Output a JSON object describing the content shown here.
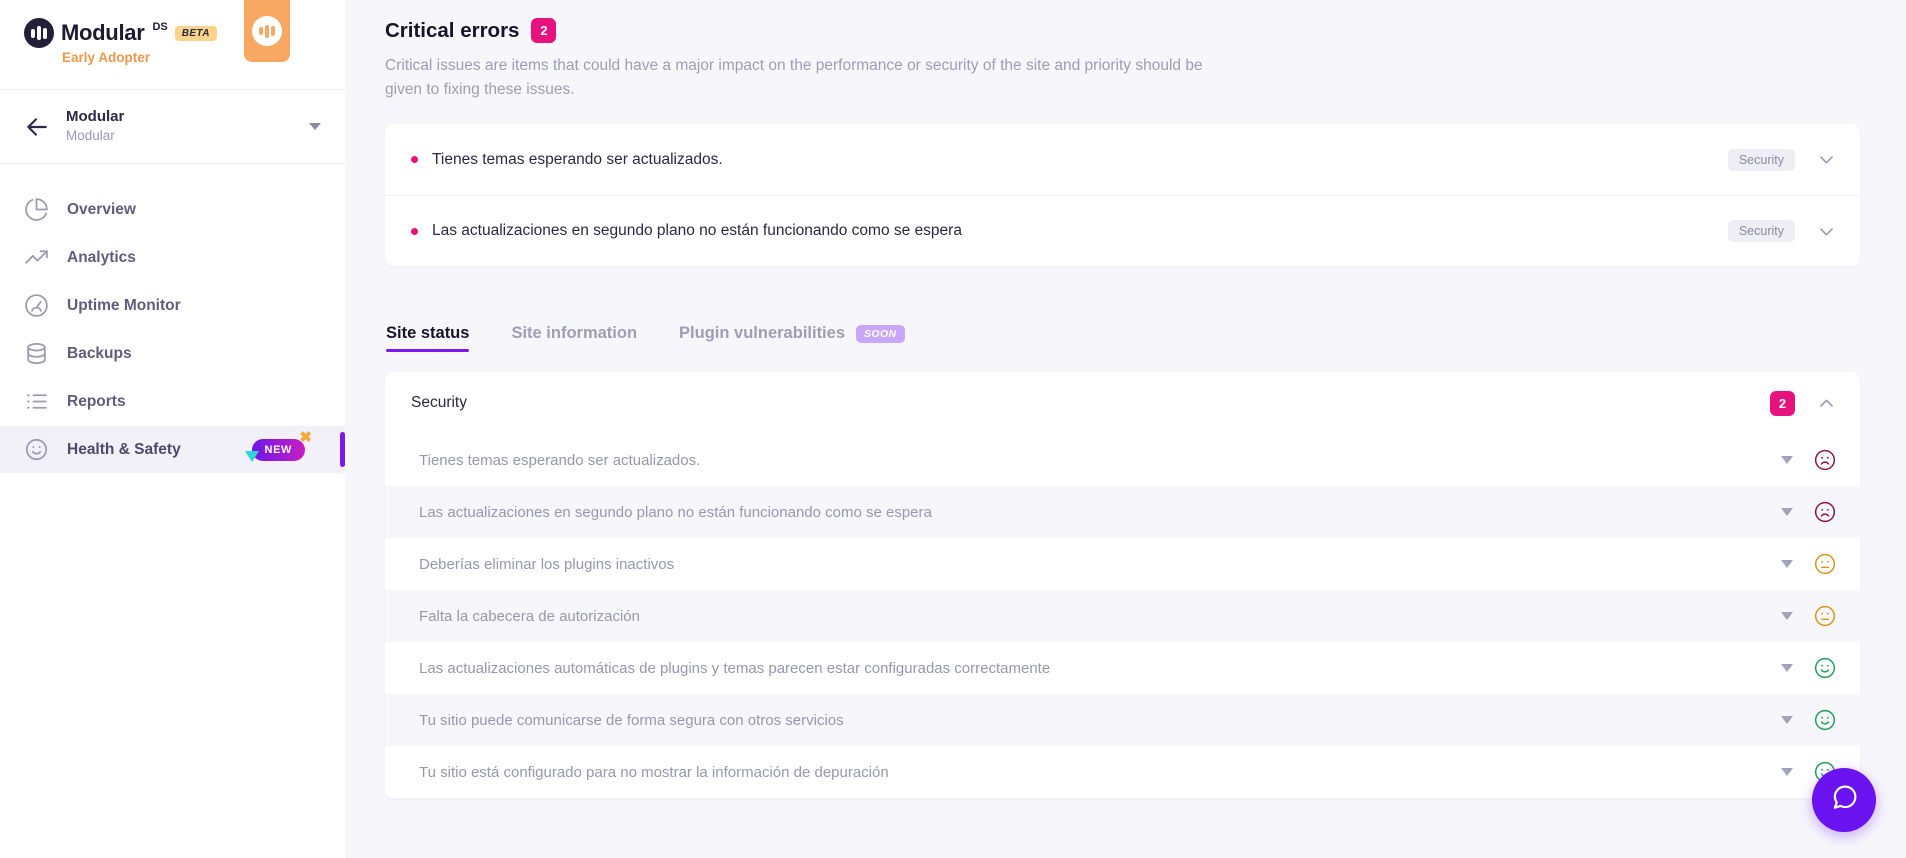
{
  "brand": {
    "name": "Modular",
    "superscript": "DS",
    "beta_label": "BETA",
    "subtitle": "Early Adopter"
  },
  "site_selector": {
    "name": "Modular",
    "host": "Modular"
  },
  "sidebar": {
    "items": [
      {
        "label": "Overview",
        "icon": "pie-chart-icon",
        "active": false
      },
      {
        "label": "Analytics",
        "icon": "trend-up-icon",
        "active": false
      },
      {
        "label": "Uptime Monitor",
        "icon": "gauge-icon",
        "active": false
      },
      {
        "label": "Backups",
        "icon": "database-icon",
        "active": false
      },
      {
        "label": "Reports",
        "icon": "list-icon",
        "active": false
      },
      {
        "label": "Health & Safety",
        "icon": "smiley-icon",
        "active": true,
        "badge": "NEW"
      }
    ]
  },
  "critical": {
    "title": "Critical errors",
    "count": "2",
    "description": "Critical issues are items that could have a major impact on the performance or security of the site and priority should be given to fixing these issues.",
    "rows": [
      {
        "text": "Tienes temas esperando ser actualizados.",
        "tag": "Security"
      },
      {
        "text": "Las actualizaciones en segundo plano no están funcionando como se espera",
        "tag": "Security"
      }
    ]
  },
  "tabs": [
    {
      "label": "Site status",
      "active": true,
      "badge": ""
    },
    {
      "label": "Site information",
      "active": false,
      "badge": ""
    },
    {
      "label": "Plugin vulnerabilities",
      "active": false,
      "badge": "SOON"
    }
  ],
  "status_section": {
    "title": "Security",
    "count": "2",
    "expanded": true,
    "issues": [
      {
        "text": "Tienes temas esperando ser actualizados.",
        "severity": "bad"
      },
      {
        "text": "Las actualizaciones en segundo plano no están funcionando como se espera",
        "severity": "bad"
      },
      {
        "text": "Deberías eliminar los plugins inactivos",
        "severity": "warn"
      },
      {
        "text": "Falta la cabecera de autorización",
        "severity": "warn"
      },
      {
        "text": "Las actualizaciones automáticas de plugins y temas parecen estar configuradas correctamente",
        "severity": "good"
      },
      {
        "text": "Tu sitio puede comunicarse de forma segura con otros servicios",
        "severity": "good"
      },
      {
        "text": "Tu sitio está configurado para no mostrar la información de depuración",
        "severity": "good"
      }
    ]
  },
  "chat": {
    "icon": "chat-bubble-icon"
  },
  "colors": {
    "accent_purple": "#7d18f0",
    "accent_pink": "#e8127e",
    "orange": "#f8a862",
    "bad": "#8e1540",
    "warn": "#d6941f",
    "good": "#1f9d55"
  }
}
